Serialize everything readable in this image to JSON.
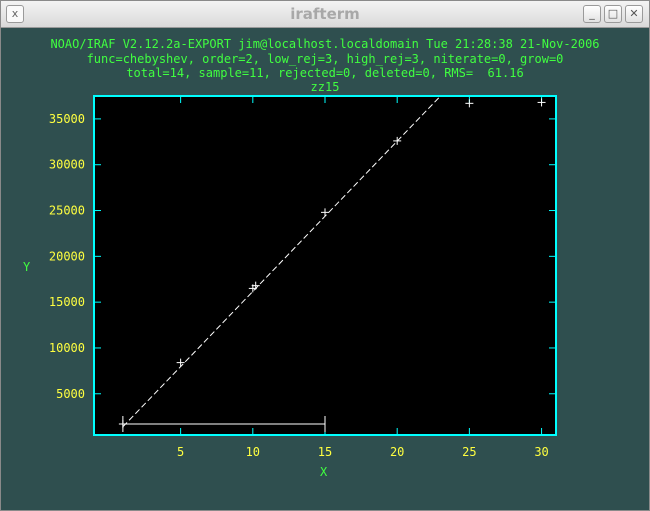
{
  "window": {
    "title": "irafterm",
    "sys_icon": "x",
    "minimize_glyph": "_",
    "maximize_glyph": "□",
    "close_glyph": "✕"
  },
  "header": {
    "line1": "NOAO/IRAF V2.12.2a-EXPORT jim@localhost.localdomain Tue 21:28:38 21-Nov-2006",
    "line2": "func=chebyshev, order=2, low_rej=3, high_rej=3, niterate=0, grow=0",
    "line3": "total=14, sample=11, rejected=0, deleted=0, RMS=  61.16",
    "line4": "zz15"
  },
  "colors": {
    "background": "#2f4f4f",
    "plot_bg": "#000000",
    "frame": "#00ffff",
    "tick_labels": "#ffff40",
    "text": "#40ff40",
    "data": "#ffffff"
  },
  "chart_data": {
    "type": "scatter",
    "title": "zz15",
    "xlabel": "X",
    "ylabel": "Y",
    "xlim": [
      -1,
      31
    ],
    "ylim": [
      500,
      37500
    ],
    "xticks": [
      5,
      10,
      15,
      20,
      25,
      30
    ],
    "yticks": [
      5000,
      10000,
      15000,
      20000,
      25000,
      30000,
      35000
    ],
    "grid": false,
    "points": [
      {
        "x": 1,
        "y": 1700
      },
      {
        "x": 5,
        "y": 8400
      },
      {
        "x": 10,
        "y": 16500
      },
      {
        "x": 10.2,
        "y": 16800
      },
      {
        "x": 15,
        "y": 24800
      },
      {
        "x": 20,
        "y": 32600
      },
      {
        "x": 25,
        "y": 36700
      },
      {
        "x": 30,
        "y": 36800
      }
    ],
    "fit_line": {
      "x1": 1,
      "y1": 1400,
      "x2": 23,
      "y2": 37500
    },
    "sample_range": {
      "x1": 1,
      "x2": 15,
      "y": 1700
    }
  }
}
